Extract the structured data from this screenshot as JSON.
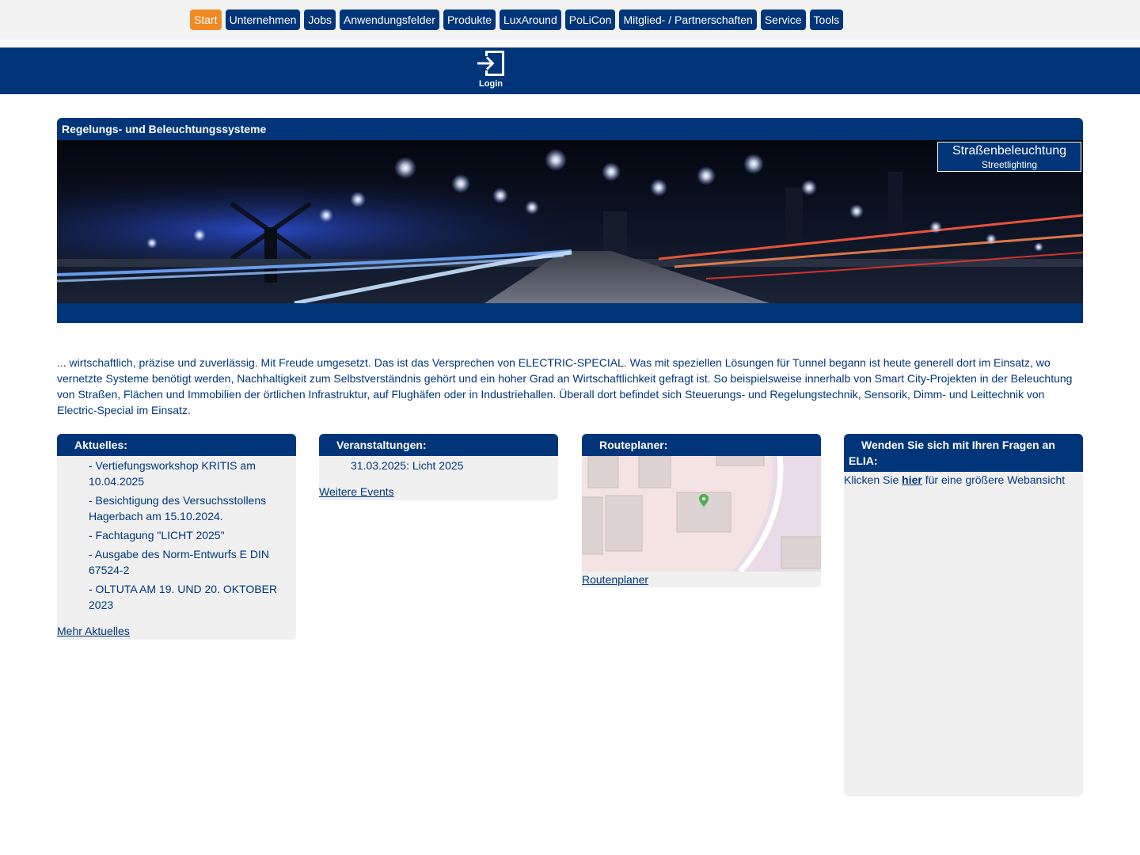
{
  "menu": {
    "items": [
      {
        "label": "Start",
        "active": true
      },
      {
        "label": "Unternehmen"
      },
      {
        "label": "Jobs"
      },
      {
        "label": "Anwendungsfelder"
      },
      {
        "label": "Produkte"
      },
      {
        "label": "LuxAround"
      },
      {
        "label": "PoLiCon"
      },
      {
        "label": "Mitglied- / Partnerschaften"
      },
      {
        "label": "Service"
      },
      {
        "label": "Tools"
      }
    ]
  },
  "login": {
    "label": "Login",
    "icon": "login-arrow-icon"
  },
  "banner": {
    "title": "Regelungs- und Beleuchtungssysteme",
    "badge_main": "Straßenbeleuchtung",
    "badge_sub": "Streetlighting"
  },
  "intro": "... wirtschaftlich, präzise und zuverlässig. Mit Freude umgesetzt. Das ist das Versprechen von ELECTRIC-SPECIAL. Was mit speziellen Lösungen für Tunnel begann ist heute generell dort im Einsatz, wo vernetzte Systeme benötigt werden, Nachhaltigkeit zum Selbstverständnis gehört und ein hoher Grad an Wirtschaftlichkeit gefragt ist. So beispielsweise innerhalb von Smart City-Projekten in der Beleuchtung von Straßen, Flächen und Immobilien der örtlichen Infrastruktur, auf Flughäfen oder in Industriehallen. Überall dort befindet sich Steuerungs- und Regelungstechnik, Sensorik, Dimm- und Leittechnik von Electric-Special im Einsatz.",
  "news": {
    "title": "Aktuelles:",
    "items": [
      "- Vertiefungsworkshop KRITIS am 10.04.2025",
      "- Besichtigung des Versuchsstollens Hagerbach am 15.10.2024.",
      "- Fachtagung \"LICHT 2025\"",
      "- Ausgabe des Norm-Entwurfs E DIN 67524-2",
      "- OLTUTA AM 19. UND 20. OKTOBER 2023"
    ],
    "more": "Mehr Aktuelles"
  },
  "events": {
    "title": "Veranstaltungen:",
    "items": [
      "31.03.2025: Licht 2025"
    ],
    "more": "Weitere Events"
  },
  "route": {
    "title": "Routeplaner:",
    "link": "Routenplaner"
  },
  "elia": {
    "title": "Wenden Sie sich mit Ihren Fragen an ELIA:",
    "text_before": "Klicken Sie ",
    "link": "hier",
    "text_after": " für eine größere Webansicht"
  },
  "colors": {
    "brand_blue": "#003679",
    "accent_orange": "#f08a24",
    "panel_grey": "#f0f0f0",
    "topbar_grey": "#f2f2f2"
  }
}
